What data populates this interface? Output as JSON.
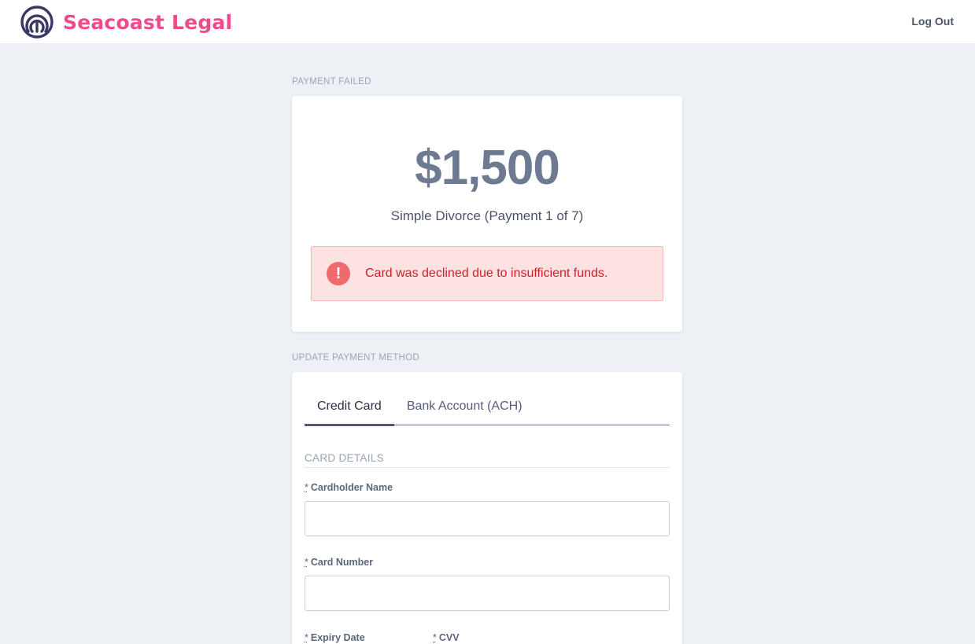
{
  "header": {
    "brand_name": "Seacoast Legal",
    "logout_label": "Log Out"
  },
  "payment_status": {
    "section_label": "PAYMENT FAILED",
    "amount": "$1,500",
    "description": "Simple Divorce (Payment 1 of 7)",
    "alert_icon": "exclamation-circle-icon",
    "alert_message": "Card was declined due to insufficient funds."
  },
  "payment_method": {
    "section_label": "UPDATE PAYMENT METHOD",
    "tabs": [
      {
        "label": "Credit Card",
        "active": true
      },
      {
        "label": "Bank Account (ACH)",
        "active": false
      }
    ],
    "card_details_heading": "CARD DETAILS",
    "required_marker": "*",
    "fields": {
      "cardholder_name": {
        "label": "Cardholder Name",
        "value": ""
      },
      "card_number": {
        "label": "Card Number",
        "value": ""
      },
      "expiry_date": {
        "label": "Expiry Date"
      },
      "cvv": {
        "label": "CVV"
      }
    }
  },
  "colors": {
    "brand": "#ec4c8a",
    "logo": "#3a3863",
    "alert_background": "#fde2e2",
    "alert_text": "#cc1f28",
    "alert_icon": "#ef6a6e",
    "amount_text": "#6d7a91",
    "page_background": "#edf1f5"
  }
}
